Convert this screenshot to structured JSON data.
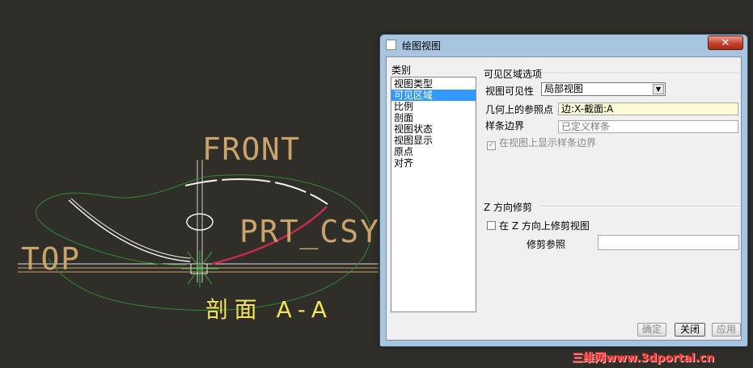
{
  "cad": {
    "front_label": "FRONT",
    "top_label": "TOP",
    "csys_label": "PRT_CSY",
    "section_label": "剖面 A-A",
    "colors": {
      "background": "#302e29",
      "datum": "#c9a36b",
      "section_text": "#f2e35a",
      "boundary": "#2f8a2f",
      "edge_highlight": "#cc2a4a",
      "geometry": "#f2f2f2"
    }
  },
  "dialog": {
    "title": "绘图视图",
    "close_symbol": "✕",
    "category_label": "类别",
    "categories": [
      "视图类型",
      "可见区域",
      "比例",
      "剖面",
      "视图状态",
      "视图显示",
      "原点",
      "对齐"
    ],
    "selected_category": "可见区域",
    "visible_area": {
      "group_title": "可见区域选项",
      "visibility_label": "视图可见性",
      "visibility_value": "局部视图",
      "geo_ref_label": "几何上的参照点",
      "geo_ref_value": "边:X-截面:A",
      "spline_label": "样条边界",
      "spline_value": "已定义样条",
      "show_spline_label": "在视图上显示样条边界",
      "show_spline_checked": true
    },
    "z_clip": {
      "group_title": "Z 方向修剪",
      "trim_label": "在 Z 方向上修剪视图",
      "trim_checked": false,
      "trim_ref_label": "修剪参照",
      "trim_ref_value": ""
    },
    "buttons": {
      "ok": "确定",
      "close": "关闭",
      "apply": "应用"
    }
  },
  "watermark": "三维网www.3dportal.cn"
}
